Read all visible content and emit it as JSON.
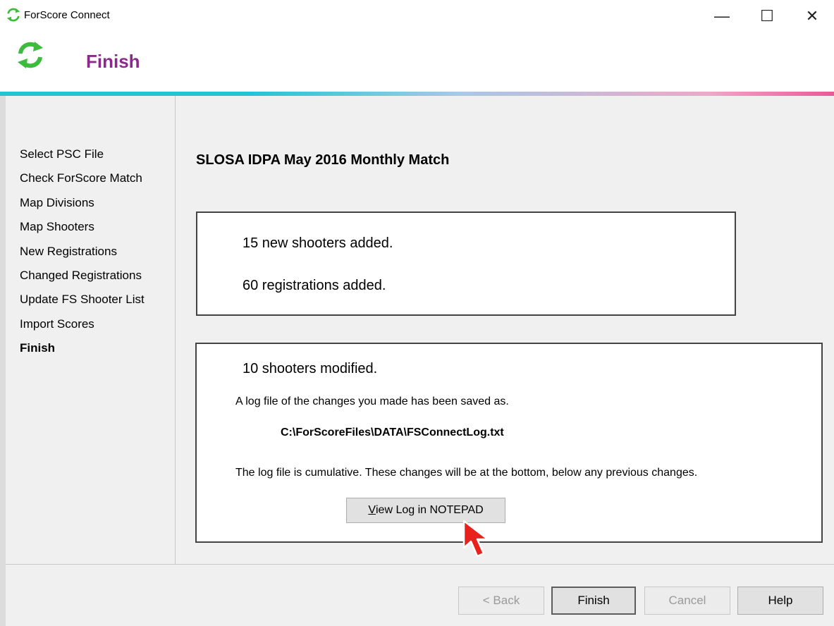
{
  "window": {
    "title": "ForScore Connect",
    "minimize_glyph": "—",
    "maximize_glyph": "☐",
    "close_glyph": "✕"
  },
  "header": {
    "title": "Finish",
    "icon": "refresh-arrows-icon"
  },
  "colors": {
    "header_title": "#8a2a8c",
    "icon_green": "#3dbb3d",
    "gradient_start": "#22c4d8",
    "gradient_end": "#e85a98"
  },
  "sidebar": {
    "items": [
      {
        "label": "Select PSC File",
        "active": false
      },
      {
        "label": "Check ForScore Match",
        "active": false
      },
      {
        "label": "Map Divisions",
        "active": false
      },
      {
        "label": "Map Shooters",
        "active": false
      },
      {
        "label": "New Registrations",
        "active": false
      },
      {
        "label": "Changed Registrations",
        "active": false
      },
      {
        "label": "Update FS Shooter List",
        "active": false
      },
      {
        "label": "Import Scores",
        "active": false
      },
      {
        "label": "Finish",
        "active": true
      }
    ]
  },
  "main": {
    "match_title": "SLOSA IDPA May 2016 Monthly Match",
    "summary": {
      "new_shooters": "15 new shooters added.",
      "registrations": "60 registrations added."
    },
    "log": {
      "modified": "10 shooters modified.",
      "saved_text": "A log file of the changes you made has been saved as.",
      "path": "C:\\ForScoreFiles\\DATA\\FSConnectLog.txt",
      "cumulative_text": "The log file is cumulative.  These changes will be at the bottom, below any previous changes.",
      "button_label_prefix": "V",
      "button_label_rest": "iew Log in NOTEPAD"
    }
  },
  "footer": {
    "back": "< Back",
    "finish": "Finish",
    "cancel": "Cancel",
    "help": "Help"
  }
}
